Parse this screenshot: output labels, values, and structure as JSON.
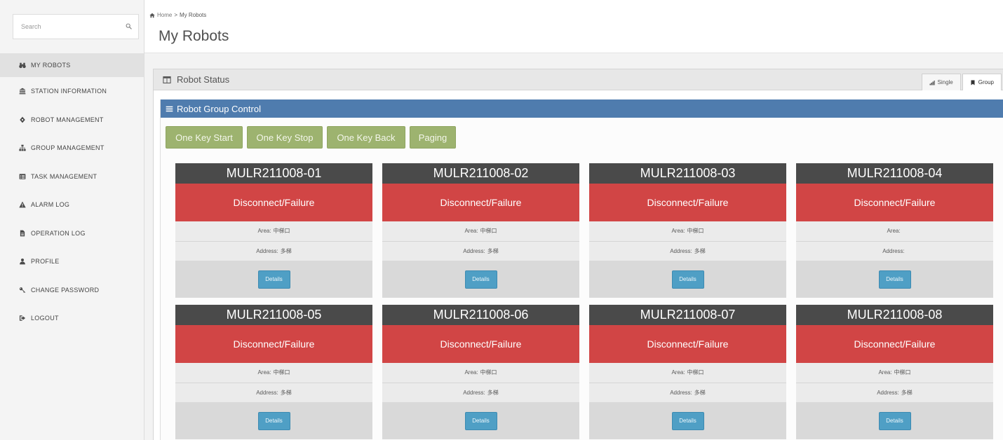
{
  "colors": {
    "accent": "#4f7cae",
    "status_failure": "#d14545",
    "card_header": "#4a4a4a",
    "action_button": "#9db36f",
    "details_button": "#4f9fc5"
  },
  "sidebar": {
    "search": {
      "placeholder": "Search",
      "icon": "search-icon"
    },
    "items": [
      {
        "label": "MY ROBOTS",
        "icon": "binoculars-icon",
        "active": true
      },
      {
        "label": "STATION INFORMATION",
        "icon": "institution-icon"
      },
      {
        "label": "ROBOT MANAGEMENT",
        "icon": "diamond-icon"
      },
      {
        "label": "GROUP MANAGEMENT",
        "icon": "sitemap-icon"
      },
      {
        "label": "TASK MANAGEMENT",
        "icon": "tasks-icon"
      },
      {
        "label": "ALARM LOG",
        "icon": "warning-icon"
      },
      {
        "label": "OPERATION LOG",
        "icon": "file-icon"
      },
      {
        "label": "PROFILE",
        "icon": "user-icon"
      },
      {
        "label": "CHANGE PASSWORD",
        "icon": "key-icon"
      },
      {
        "label": "LOGOUT",
        "icon": "sign-out-icon"
      }
    ]
  },
  "breadcrumb": {
    "home": "Home",
    "separator": ">",
    "current": "My Robots"
  },
  "page_title": "My Robots",
  "panel": {
    "title": "Robot Status",
    "icon": "table-icon",
    "tabs": [
      {
        "label": "Single",
        "icon": "signal-icon",
        "active": false
      },
      {
        "label": "Group",
        "icon": "bookmark-icon",
        "active": true
      }
    ]
  },
  "group_control": {
    "title": "Robot Group Control",
    "icon": "bars-icon",
    "buttons": [
      {
        "label": "One Key Start"
      },
      {
        "label": "One Key Stop"
      },
      {
        "label": "One Key Back"
      },
      {
        "label": "Paging"
      }
    ]
  },
  "card_labels": {
    "area": "Area:",
    "address": "Address:",
    "details": "Details"
  },
  "robots": [
    {
      "name": "MULR211008-01",
      "status": "Disconnect/Failure",
      "area": "中梯口",
      "address": "多梯"
    },
    {
      "name": "MULR211008-02",
      "status": "Disconnect/Failure",
      "area": "中梯口",
      "address": "多梯"
    },
    {
      "name": "MULR211008-03",
      "status": "Disconnect/Failure",
      "area": "中梯口",
      "address": "多梯"
    },
    {
      "name": "MULR211008-04",
      "status": "Disconnect/Failure"
    },
    {
      "name": "MULR211008-05",
      "status": "Disconnect/Failure",
      "area": "中梯口",
      "address": "多梯"
    },
    {
      "name": "MULR211008-06",
      "status": "Disconnect/Failure",
      "area": "中梯口",
      "address": "多梯"
    },
    {
      "name": "MULR211008-07",
      "status": "Disconnect/Failure",
      "area": "中梯口",
      "address": "多梯"
    },
    {
      "name": "MULR211008-08",
      "status": "Disconnect/Failure",
      "area": "中梯口",
      "address": "多梯"
    }
  ]
}
